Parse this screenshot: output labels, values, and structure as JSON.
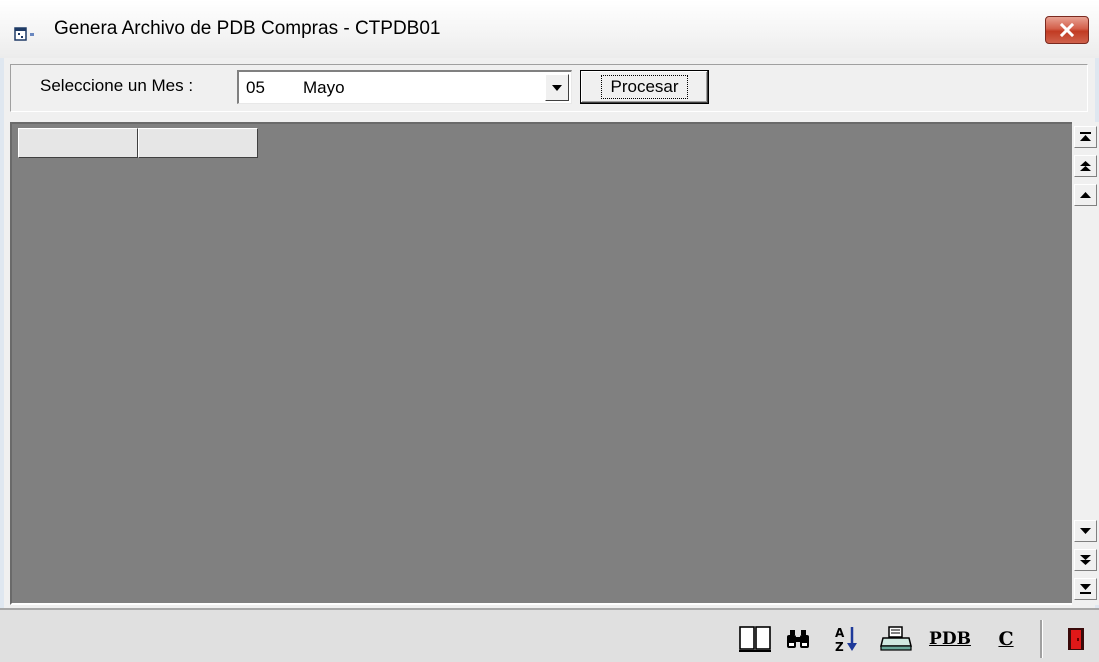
{
  "window": {
    "title": "Genera Archivo de PDB Compras - CTPDB01",
    "close_glyph": "✕"
  },
  "filter": {
    "label": "Seleccione un Mes :",
    "selected_code": "05",
    "selected_name": "Mayo",
    "process_label": "Procesar"
  },
  "grid": {
    "columns": [
      "",
      ""
    ],
    "rows": []
  },
  "toolbar": {
    "pdb_label": "PDB",
    "c_label": "C"
  },
  "icons": {
    "app": "app-window-icon",
    "book": "book-icon",
    "search": "binoculars-icon",
    "sort": "sort-az-icon",
    "print": "printer-icon",
    "exit": "exit-door-icon"
  }
}
